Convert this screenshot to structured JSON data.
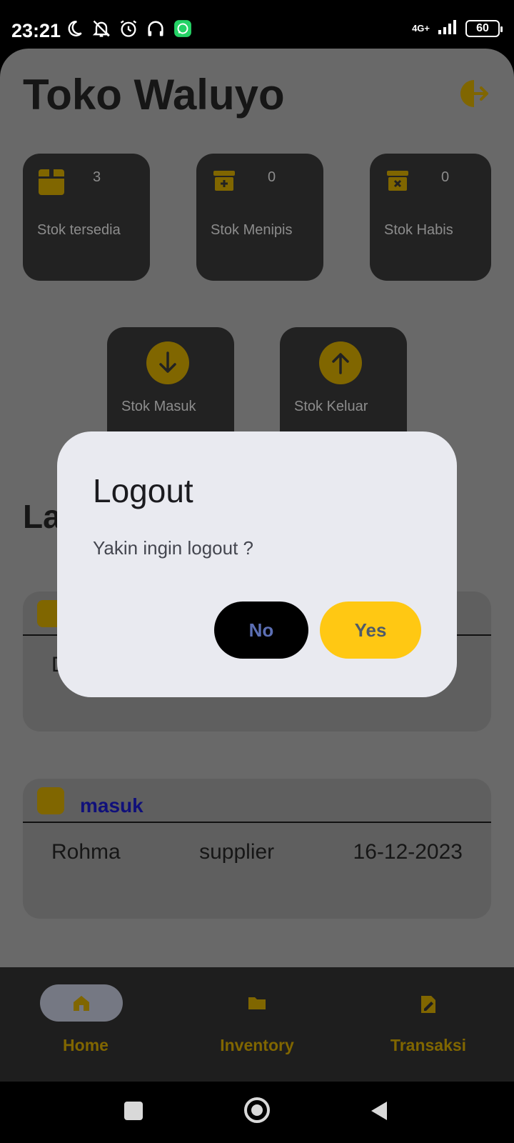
{
  "status_bar": {
    "time": "23:21",
    "network": "4G+",
    "battery": "60"
  },
  "app": {
    "title": "Toko Waluyo"
  },
  "stats": [
    {
      "label": "Stok tersedia",
      "count": "3"
    },
    {
      "label": "Stok Menipis",
      "count": "0"
    },
    {
      "label": "Stok Habis",
      "count": "0"
    }
  ],
  "actions": [
    {
      "label": "Stok Masuk"
    },
    {
      "label": "Stok Keluar"
    }
  ],
  "section": {
    "title_partial": "La"
  },
  "transactions": [
    {
      "type": "",
      "row_partial": "D"
    },
    {
      "type": "masuk",
      "name": "Rohma",
      "party": "supplier",
      "date": "16-12-2023"
    }
  ],
  "bottom_nav": [
    {
      "label": "Home",
      "active": true
    },
    {
      "label": "Inventory",
      "active": false
    },
    {
      "label": "Transaksi",
      "active": false
    }
  ],
  "dialog": {
    "title": "Logout",
    "message": "Yakin ingin logout ?",
    "no_label": "No",
    "yes_label": "Yes"
  },
  "colors": {
    "accent": "#FFC813",
    "dim_accent": "#806600",
    "dialog_bg": "#E9EAF0"
  }
}
